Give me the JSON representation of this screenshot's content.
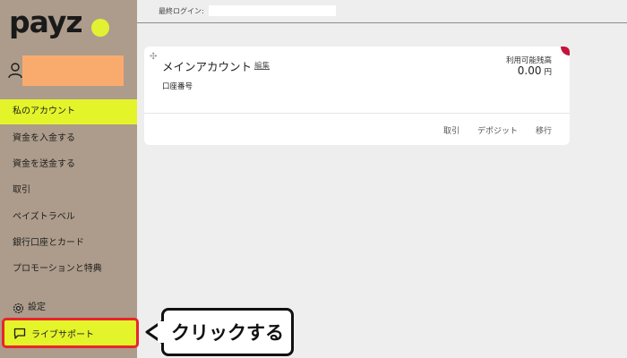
{
  "brand": {
    "logo_text": "payz",
    "dot_color": "#e2f233"
  },
  "user": {
    "icon": "user-icon",
    "name_redacted_color": "#f9ab6e"
  },
  "sidebar": {
    "background": "#ad9c8b",
    "active_color": "#e3f42a",
    "items": [
      {
        "label": "私のアカウント",
        "active": true
      },
      {
        "label": "資金を入金する"
      },
      {
        "label": "資金を送金する"
      },
      {
        "label": "取引"
      },
      {
        "label": "ペイズトラベル"
      },
      {
        "label": "銀行口座とカード"
      },
      {
        "label": "プロモーションと特典"
      }
    ],
    "settings": {
      "label": "設定",
      "icon": "gear-icon"
    },
    "live_support": {
      "label": "ライブサポート",
      "icon": "chat-bubble-icon",
      "highlight_border": "#e8262c"
    }
  },
  "callout": {
    "text": "クリックする"
  },
  "topbar": {
    "last_login_label": "最終ログイン:"
  },
  "account_card": {
    "title": "メインアカウント",
    "edit_label": "編集",
    "account_number_label": "口座番号",
    "balance_label": "利用可能残高",
    "balance_value": "0.00",
    "balance_unit": "円",
    "actions": [
      "取引",
      "デポジット",
      "移行"
    ],
    "corner_color": "#c4143c"
  }
}
